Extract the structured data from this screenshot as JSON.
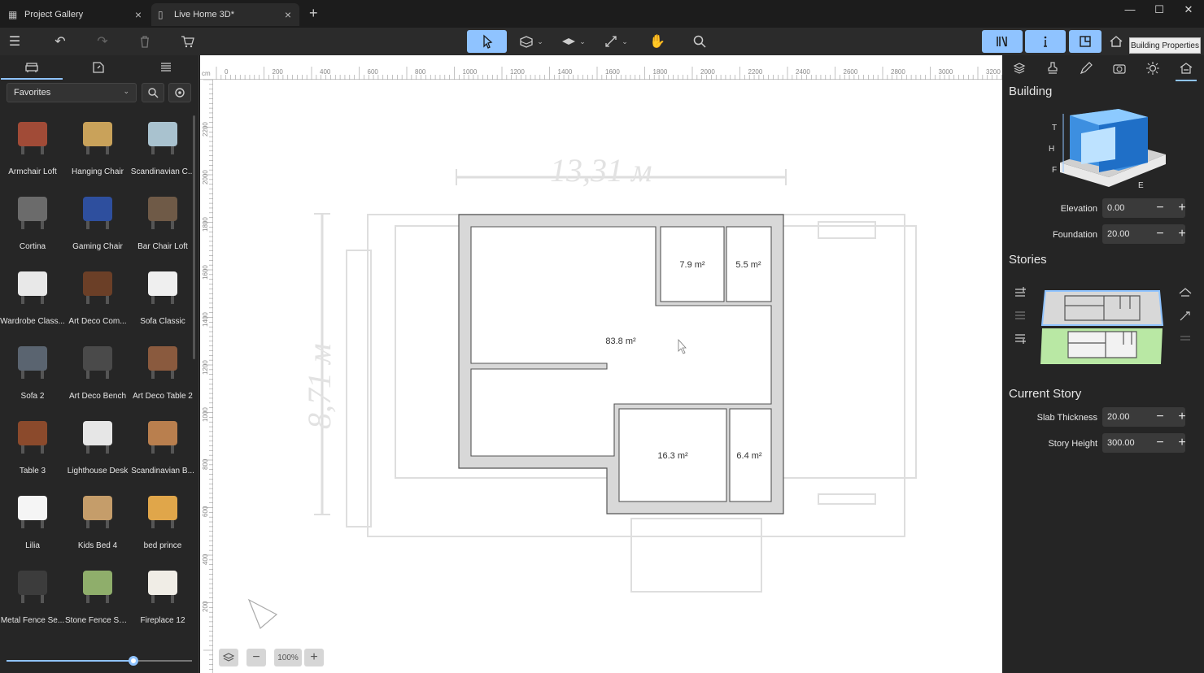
{
  "tabs": [
    {
      "label": "Project Gallery",
      "icon": "gallery-icon"
    },
    {
      "label": "Live Home 3D*",
      "icon": "document-icon"
    }
  ],
  "toolbar": {
    "tools": [
      "menu-icon",
      "undo-icon",
      "redo-icon",
      "trash-icon",
      "cart-icon",
      "select-icon",
      "wall-tool-icon",
      "floor-tool-icon",
      "dimension-tool-icon",
      "hand-icon",
      "search-icon"
    ],
    "right_tools": [
      "library-icon",
      "info-icon",
      "plan-view-icon",
      "home-3d-icon",
      "split-view-icon",
      "building-properties-icon"
    ]
  },
  "tooltip": "Building Properties",
  "library": {
    "filter": "Favorites",
    "items": [
      {
        "label": "Armchair Loft",
        "color": "#a14b37"
      },
      {
        "label": "Hanging Chair",
        "color": "#c9a25a"
      },
      {
        "label": "Scandinavian C...",
        "color": "#a9c2cf"
      },
      {
        "label": "Cortina",
        "color": "#6b6b6b"
      },
      {
        "label": "Gaming Chair",
        "color": "#2e4f9e"
      },
      {
        "label": "Bar Chair Loft",
        "color": "#6f5a47"
      },
      {
        "label": "Wardrobe Class...",
        "color": "#e8e8e8"
      },
      {
        "label": "Art Deco Com...",
        "color": "#6b3f27"
      },
      {
        "label": "Sofa Classic",
        "color": "#efefef"
      },
      {
        "label": "Sofa 2",
        "color": "#5a6470"
      },
      {
        "label": "Art Deco Bench",
        "color": "#4a4a4a"
      },
      {
        "label": "Art Deco Table 2",
        "color": "#8a5a3e"
      },
      {
        "label": "Table 3",
        "color": "#8b4a2c"
      },
      {
        "label": "Lighthouse Desk",
        "color": "#e6e6e6"
      },
      {
        "label": "Scandinavian B...",
        "color": "#b97f4e"
      },
      {
        "label": "Lilia",
        "color": "#f5f5f5"
      },
      {
        "label": "Kids Bed 4",
        "color": "#c59d6a"
      },
      {
        "label": "bed prince",
        "color": "#e0a64a"
      },
      {
        "label": "Metal Fence Se...",
        "color": "#3c3c3c"
      },
      {
        "label": "Stone Fence Se...",
        "color": "#8fae6b"
      },
      {
        "label": "Fireplace 12",
        "color": "#f0ede6"
      }
    ]
  },
  "ruler": {
    "unit": "cm",
    "top_ticks": [
      "0",
      "200",
      "400",
      "600",
      "800",
      "1000",
      "1200",
      "1400",
      "1600",
      "1800",
      "2000",
      "2200",
      "2400",
      "2600",
      "2800",
      "3000",
      "3200"
    ],
    "left_ticks": [
      "2200",
      "2000",
      "1800",
      "1600",
      "1400",
      "1200",
      "1000",
      "800",
      "600",
      "400",
      "200"
    ]
  },
  "plan": {
    "sketch_width": "13,31 м",
    "sketch_height": "8,71 м",
    "rooms": [
      {
        "area": "7.9 m²"
      },
      {
        "area": "5.5 m²"
      },
      {
        "area": "83.8 m²"
      },
      {
        "area": "16.3 m²"
      },
      {
        "area": "6.4 m²"
      }
    ]
  },
  "zoom": {
    "level": "100%"
  },
  "building": {
    "title": "Building",
    "letters": [
      "T",
      "H",
      "F",
      "E"
    ],
    "elevation_label": "Elevation",
    "elevation": "0.00",
    "foundation_label": "Foundation",
    "foundation": "20.00"
  },
  "stories": {
    "title": "Stories"
  },
  "current_story": {
    "title": "Current Story",
    "slab_label": "Slab Thickness",
    "slab": "20.00",
    "height_label": "Story Height",
    "height": "300.00"
  },
  "colors": {
    "accent": "#8fc3ff",
    "panel": "#262626",
    "canvas": "#ffffff"
  }
}
